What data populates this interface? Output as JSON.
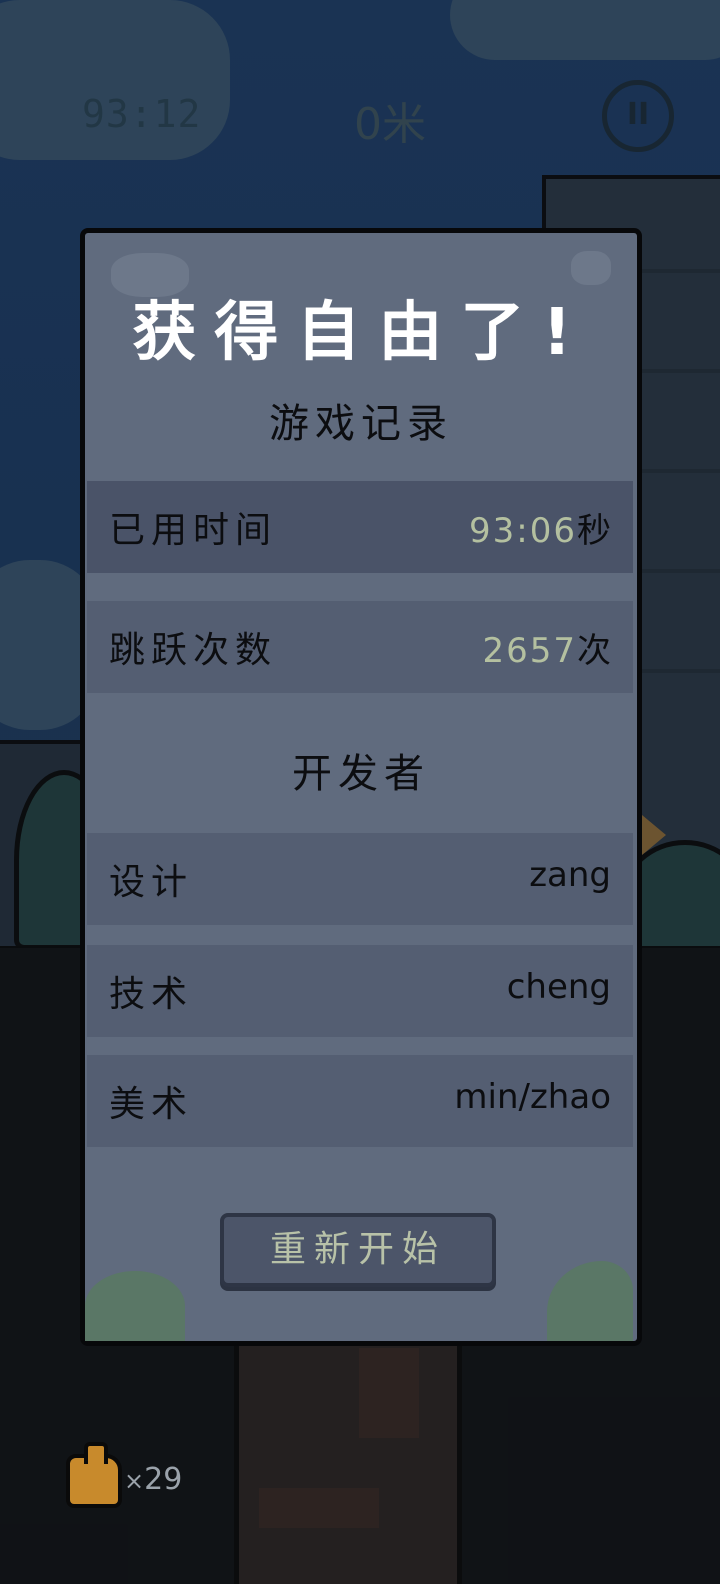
{
  "hud": {
    "timer": "93:12",
    "distance": "0米",
    "pause_symbol": "II"
  },
  "dialog": {
    "title": "获得自由了!",
    "record_heading": "游戏记录",
    "stats": [
      {
        "label": "已用时间",
        "value": "93:06",
        "unit": "秒"
      },
      {
        "label": "跳跃次数",
        "value": "2657",
        "unit": "次"
      }
    ],
    "credits_heading": "开发者",
    "credits": [
      {
        "role": "设计",
        "name": "zang"
      },
      {
        "role": "技术",
        "name": "cheng"
      },
      {
        "role": "美术",
        "name": "min/zhao"
      }
    ],
    "restart_label": "重新开始"
  },
  "inventory": {
    "count_prefix": "×",
    "count": "29",
    "icon": "thumbs-up-icon"
  },
  "colors": {
    "panel_bg": "#606b7e",
    "row_bg": "#545e72",
    "value_accent": "#b4c0a0",
    "sky": "#1f3f69"
  }
}
